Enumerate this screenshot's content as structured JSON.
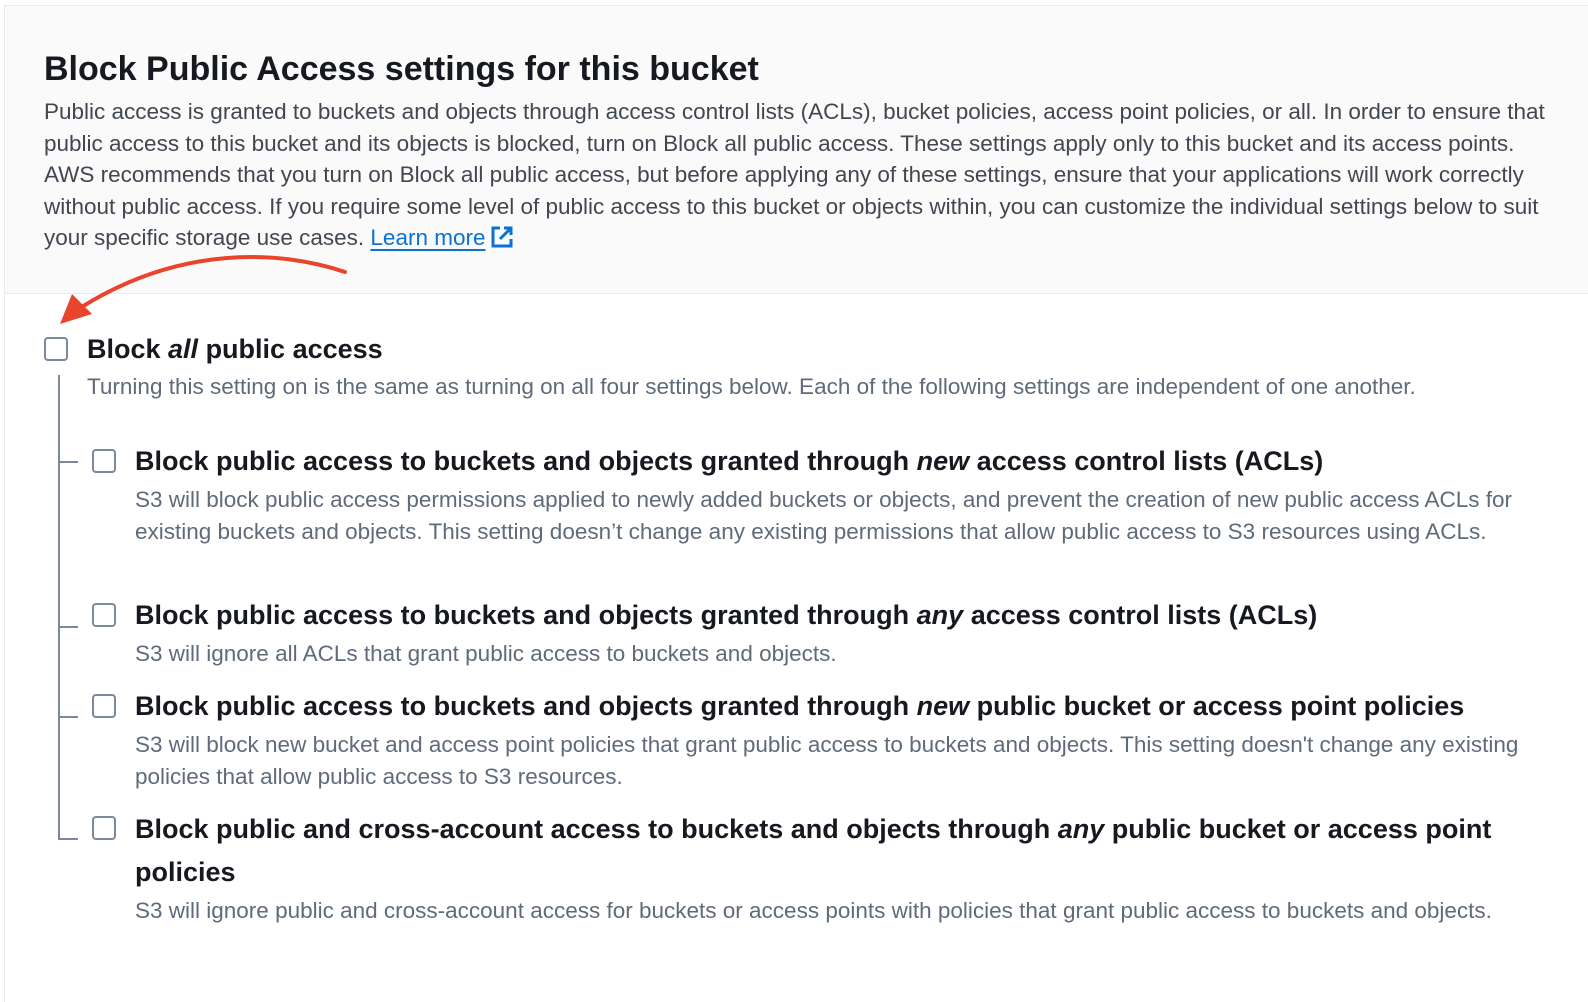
{
  "header": {
    "title": "Block Public Access settings for this bucket",
    "description": "Public access is granted to buckets and objects through access control lists (ACLs), bucket policies, access point policies, or all. In order to ensure that public access to this bucket and its objects is blocked, turn on Block all public access. These settings apply only to this bucket and its access points. AWS recommends that you turn on Block all public access, but before applying any of these settings, ensure that your applications will work correctly without public access. If you require some level of public access to this bucket or objects within, you can customize the individual settings below to suit your specific storage use cases.",
    "learn_more": "Learn more"
  },
  "block_all": {
    "label_pre": "Block ",
    "label_em": "all",
    "label_post": " public access",
    "description": "Turning this setting on is the same as turning on all four settings below. Each of the following settings are independent of one another.",
    "checked": false
  },
  "settings": [
    {
      "label_pre": "Block public access to buckets and objects granted through ",
      "label_em": "new",
      "label_post": " access control lists (ACLs)",
      "description": "S3 will block public access permissions applied to newly added buckets or objects, and prevent the creation of new public access ACLs for existing buckets and objects. This setting doesn’t change any existing permissions that allow public access to S3 resources using ACLs.",
      "checked": false
    },
    {
      "label_pre": "Block public access to buckets and objects granted through ",
      "label_em": "any",
      "label_post": " access control lists (ACLs)",
      "description": "S3 will ignore all ACLs that grant public access to buckets and objects.",
      "checked": false
    },
    {
      "label_pre": "Block public access to buckets and objects granted through ",
      "label_em": "new",
      "label_post": " public bucket or access point policies",
      "description": "S3 will block new bucket and access point policies that grant public access to buckets and objects. This setting doesn't change any existing policies that allow public access to S3 resources.",
      "checked": false
    },
    {
      "label_pre": "Block public and cross-account access to buckets and objects through ",
      "label_em": "any",
      "label_post": " public bucket or access point policies",
      "description": "S3 will ignore public and cross-account access for buckets or access points with policies that grant public access to buckets and objects.",
      "checked": false
    }
  ],
  "colors": {
    "annotation_arrow": "#e8452c",
    "link": "#0972d3"
  }
}
